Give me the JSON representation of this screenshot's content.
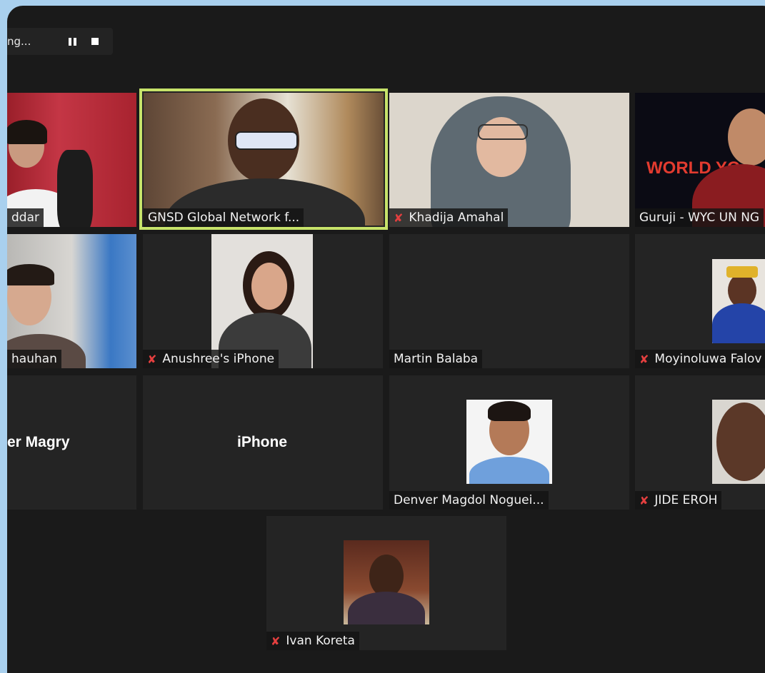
{
  "recording": {
    "label": "ng...",
    "pause_icon": "pause-icon",
    "stop_icon": "stop-icon"
  },
  "colors": {
    "window": "#1a1a1a",
    "tile": "#242424",
    "active_border": "#c7e36a",
    "muted": "#e43f3f"
  },
  "participants": [
    {
      "name": "ddar",
      "muted": false
    },
    {
      "name": "GNSD Global Network f...",
      "muted": false,
      "active_speaker": true
    },
    {
      "name": "Khadija Amahal",
      "muted": true
    },
    {
      "name": "Guruji - WYC UN NG",
      "muted": false,
      "overlay_text": "WORLD YO"
    },
    {
      "name": "hauhan",
      "muted": false
    },
    {
      "name": "Anushree's iPhone",
      "muted": true
    },
    {
      "name": "Martin Balaba",
      "muted": false
    },
    {
      "name": "Moyinoluwa Falov",
      "muted": true
    },
    {
      "name": "er Magry",
      "muted": false,
      "video": false
    },
    {
      "name": "iPhone",
      "muted": false,
      "video": false
    },
    {
      "name": "Denver Magdol Noguei...",
      "muted": false
    },
    {
      "name": "JIDE EROH",
      "muted": true
    },
    {
      "name": "Ivan Koreta",
      "muted": true
    }
  ]
}
